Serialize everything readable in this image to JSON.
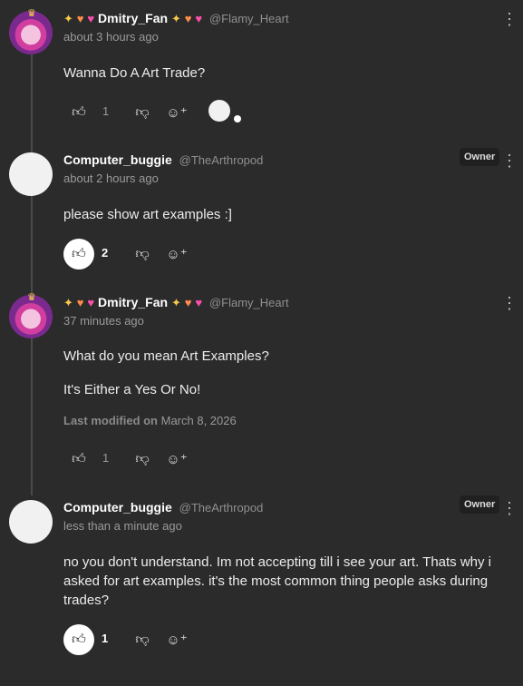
{
  "comments": [
    {
      "name": "Dmitry_Fan",
      "handle": "@Flamy_Heart",
      "time": "about 3 hours ago",
      "text": "Wanna Do A Art Trade?",
      "likes": "1",
      "owner": ""
    },
    {
      "name": "Computer_buggie",
      "handle": "@TheArthropod",
      "time": "about 2 hours ago",
      "text": "please show art examples :]",
      "likes": "2",
      "owner": "Owner"
    },
    {
      "name": "Dmitry_Fan",
      "handle": "@Flamy_Heart",
      "time": "37 minutes ago",
      "text_lines": [
        "What do you mean Art Examples?",
        "It's Either a Yes Or No!"
      ],
      "modified_label": "Last modified on",
      "modified_date": "March 8, 2026",
      "likes": "1",
      "owner": ""
    },
    {
      "name": "Computer_buggie",
      "handle": "@TheArthropod",
      "time": "less than a minute ago",
      "text": "no you don't understand. Im not accepting till i see your art. Thats why i asked for art examples. it's the most common thing people asks during trades?",
      "likes": "1",
      "owner": "Owner"
    }
  ],
  "icons": {
    "like": "thumbs-up-icon",
    "dislike": "thumbs-down-icon",
    "react": "add-reaction-icon",
    "more": "more-vertical-icon"
  }
}
